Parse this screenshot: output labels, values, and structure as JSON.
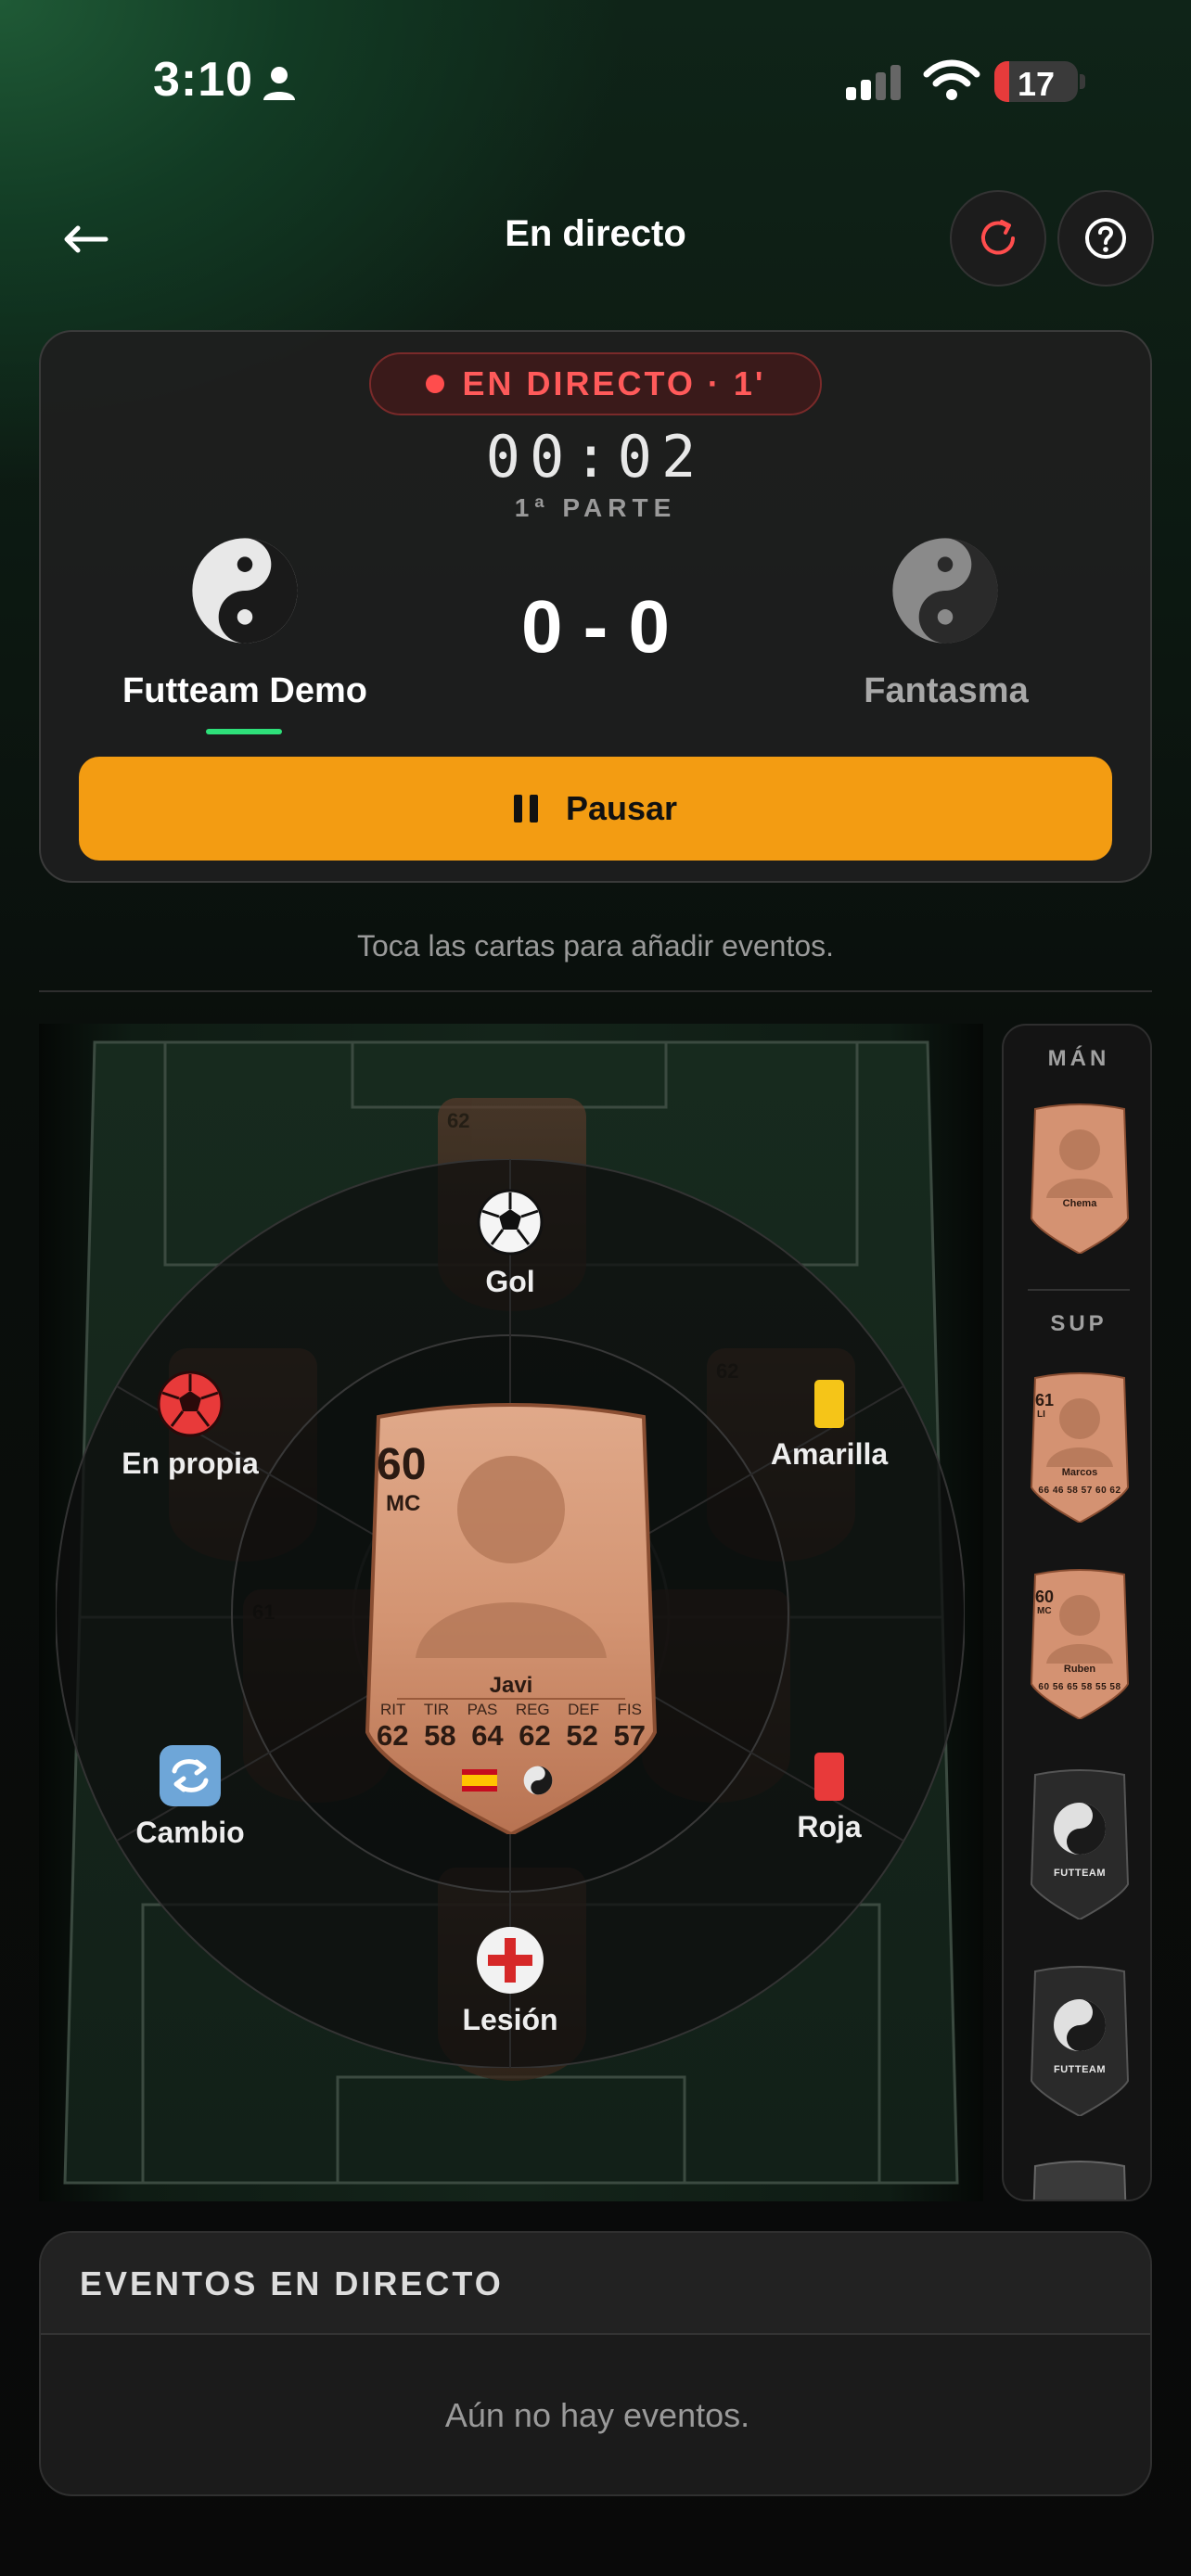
{
  "status_bar": {
    "time": "3:10",
    "battery": "17"
  },
  "header": {
    "title": "En directo"
  },
  "match": {
    "live_label": "EN DIRECTO · 1'",
    "clock": "00:02",
    "period": "1ª PARTE",
    "home_team": "Futteam Demo",
    "away_team": "Fantasma",
    "score": "0 - 0",
    "pause_label": "Pausar"
  },
  "hint": "Toca las cartas para añadir eventos.",
  "actions": {
    "goal": "Gol",
    "own_goal": "En propia",
    "yellow": "Amarilla",
    "sub": "Cambio",
    "red": "Roja",
    "injury": "Lesión"
  },
  "selected_player": {
    "rating": "60",
    "position": "MC",
    "name": "Javi",
    "stat_labels": [
      "RIT",
      "TIR",
      "PAS",
      "REG",
      "DEF",
      "FIS"
    ],
    "stat_values": [
      "62",
      "58",
      "64",
      "62",
      "52",
      "57"
    ]
  },
  "pitch_cards": {
    "top": "62",
    "right": "62",
    "left_low": "61"
  },
  "bench": {
    "label_top": "MÁN",
    "label_sub": "SUP",
    "cards": [
      {
        "rating": "",
        "position": "",
        "name": "Chema",
        "stats": ""
      },
      {
        "rating": "61",
        "position": "LI",
        "name": "Marcos",
        "stats": "66 46 58 57 60 62"
      },
      {
        "rating": "60",
        "position": "MC",
        "name": "Ruben",
        "stats": "60 56 65 58 55 58"
      }
    ],
    "dark_card_label": "FUTTEAM"
  },
  "events": {
    "title": "EVENTOS EN DIRECTO",
    "empty": "Aún no hay eventos."
  },
  "colors": {
    "accent": "#f39c12",
    "live": "#ff5a5a",
    "home_indicator": "#2ee07a"
  }
}
